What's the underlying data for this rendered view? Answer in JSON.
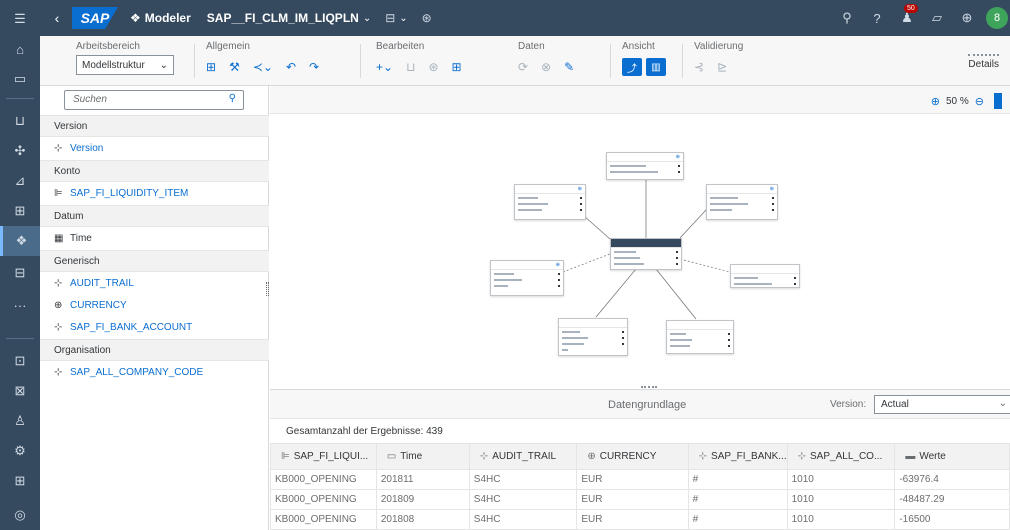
{
  "shell": {
    "logo": "SAP",
    "app_name": "Modeler",
    "model_name": "SAP__FI_CLM_IM_LIQPLN",
    "notification_count": "50",
    "avatar_initial": "8"
  },
  "toolbar": {
    "workspace_label": "Arbeitsbereich",
    "workspace_value": "Modellstruktur",
    "general_label": "Allgemein",
    "edit_label": "Bearbeiten",
    "data_label": "Daten",
    "view_label": "Ansicht",
    "validation_label": "Validierung",
    "details_label": "Details"
  },
  "left_panel": {
    "search_placeholder": "Suchen",
    "sections": [
      {
        "header": "Version",
        "items": [
          {
            "label": "Version",
            "icon": "version-icon"
          }
        ]
      },
      {
        "header": "Konto",
        "items": [
          {
            "label": "SAP_FI_LIQUIDITY_ITEM",
            "icon": "account-icon"
          }
        ]
      },
      {
        "header": "Datum",
        "items": [
          {
            "label": "Time",
            "icon": "calendar-icon"
          }
        ]
      },
      {
        "header": "Generisch",
        "items": [
          {
            "label": "AUDIT_TRAIL",
            "icon": "dimension-icon"
          },
          {
            "label": "CURRENCY",
            "icon": "currency-icon"
          },
          {
            "label": "SAP_FI_BANK_ACCOUNT",
            "icon": "dimension-icon"
          }
        ]
      },
      {
        "header": "Organisation",
        "items": [
          {
            "label": "SAP_ALL_COMPANY_CODE",
            "icon": "dimension-icon"
          }
        ]
      }
    ]
  },
  "canvas": {
    "zoom": "50 %"
  },
  "data_preview": {
    "title": "Datengrundlage",
    "version_label": "Version:",
    "version_value": "Actual",
    "total": "Gesamtanzahl der Ergebnisse: 439",
    "columns": [
      "SAP_FI_LIQUI...",
      "Time",
      "AUDIT_TRAIL",
      "CURRENCY",
      "SAP_FI_BANK...",
      "SAP_ALL_CO...",
      "Werte"
    ],
    "rows": [
      [
        "KB000_OPENING",
        "201811",
        "S4HC",
        "EUR",
        "#",
        "1010",
        "-63976.4"
      ],
      [
        "KB000_OPENING",
        "201809",
        "S4HC",
        "EUR",
        "#",
        "1010",
        "-48487.29"
      ],
      [
        "KB000_OPENING",
        "201808",
        "S4HC",
        "EUR",
        "#",
        "1010",
        "-16500"
      ]
    ]
  },
  "colors": {
    "shell": "#354a5f",
    "accent": "#0a6ed1"
  }
}
